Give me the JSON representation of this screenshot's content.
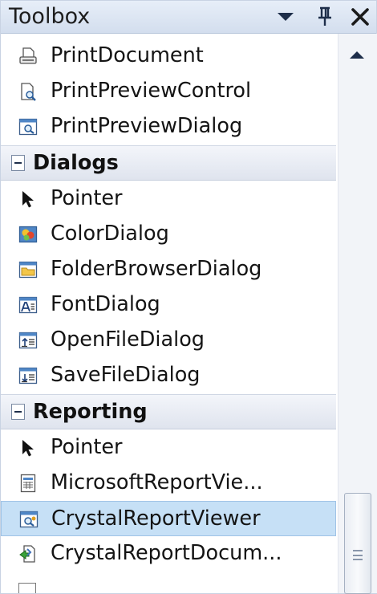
{
  "toolbox": {
    "title": "Toolbox",
    "buttons": {
      "dropdown_icon": "chevron-down-icon",
      "pin_icon": "pin-icon",
      "close_icon": "close-icon"
    },
    "items_before": [
      {
        "label": "PrintDocument",
        "icon": "print-document-icon"
      },
      {
        "label": "PrintPreviewControl",
        "icon": "print-preview-control-icon"
      },
      {
        "label": "PrintPreviewDialog",
        "icon": "print-preview-dialog-icon"
      }
    ],
    "categories": [
      {
        "label": "Dialogs",
        "expanded": true,
        "items": [
          {
            "label": "Pointer",
            "icon": "pointer-icon"
          },
          {
            "label": "ColorDialog",
            "icon": "color-dialog-icon"
          },
          {
            "label": "FolderBrowserDialog",
            "icon": "folder-browser-dialog-icon"
          },
          {
            "label": "FontDialog",
            "icon": "font-dialog-icon"
          },
          {
            "label": "OpenFileDialog",
            "icon": "open-file-dialog-icon"
          },
          {
            "label": "SaveFileDialog",
            "icon": "save-file-dialog-icon"
          }
        ]
      },
      {
        "label": "Reporting",
        "expanded": true,
        "items": [
          {
            "label": "Pointer",
            "icon": "pointer-icon"
          },
          {
            "label": "MicrosoftReportVie...",
            "icon": "microsoft-report-viewer-icon"
          },
          {
            "label": "CrystalReportViewer",
            "icon": "crystal-report-viewer-icon",
            "selected": true
          },
          {
            "label": "CrystalReportDocum...",
            "icon": "crystal-report-document-icon"
          }
        ]
      }
    ],
    "colors": {
      "selection": "#c6e0f6",
      "title_bar": "#dbe4f2",
      "category_header": "#e6eaf2"
    }
  }
}
